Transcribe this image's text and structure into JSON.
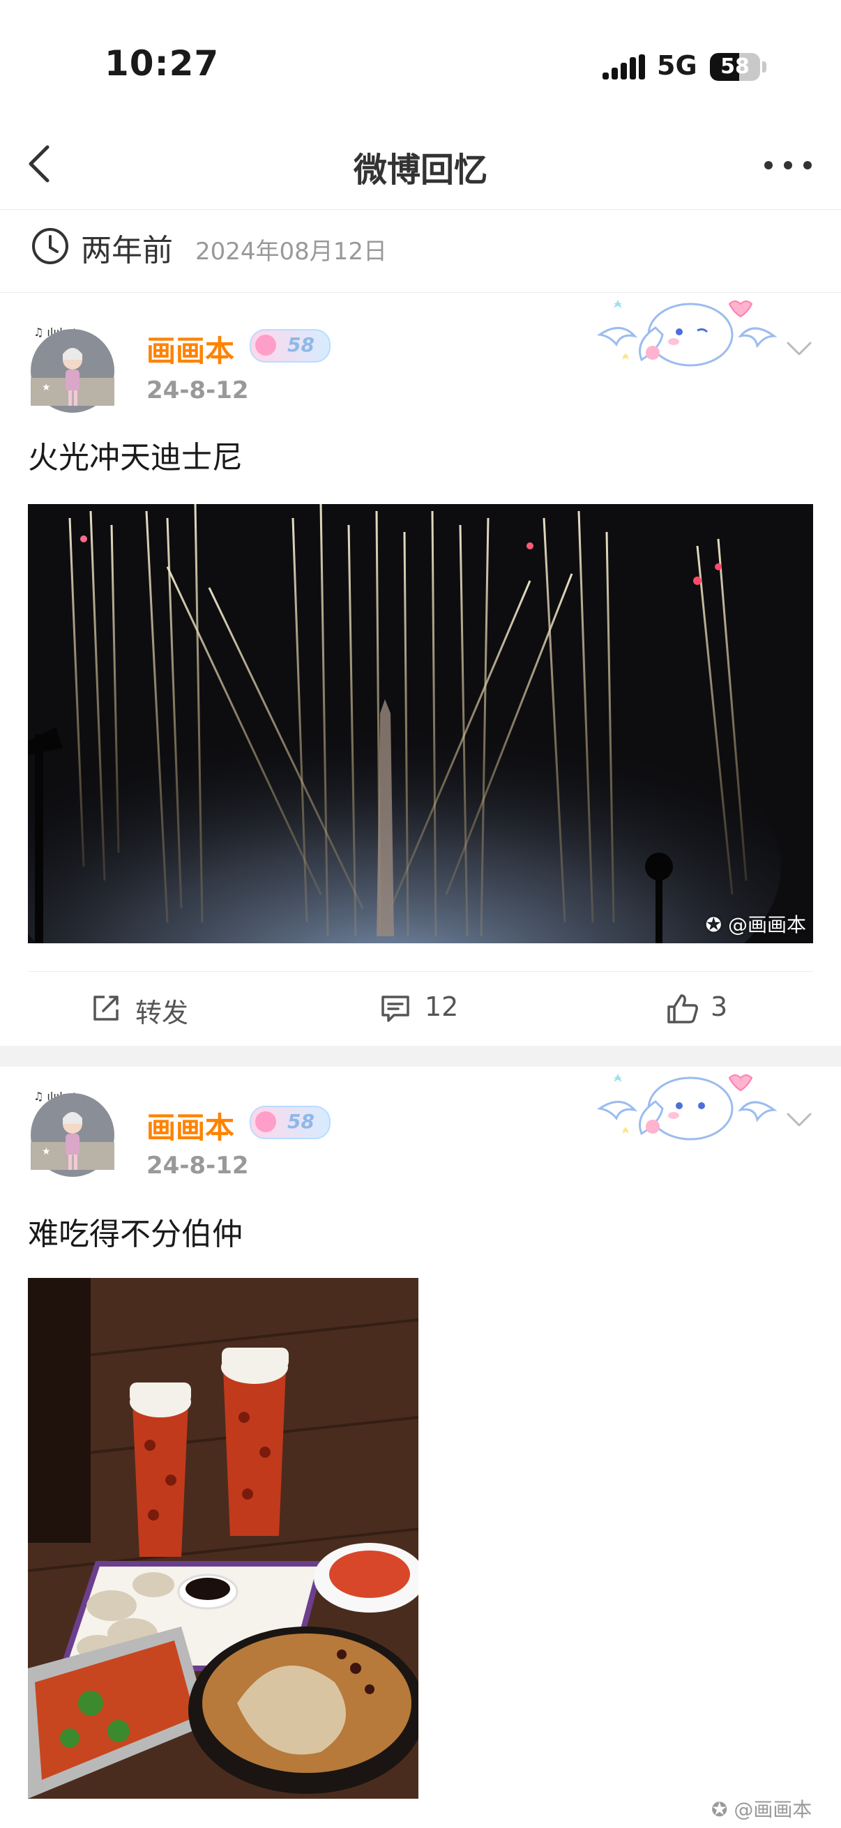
{
  "status": {
    "time": "10:27",
    "network": "5G",
    "battery": "58",
    "battery_level": 0.58
  },
  "nav": {
    "title": "微博回忆"
  },
  "memory": {
    "ago": "两年前",
    "date": "2024年08月12日"
  },
  "colors": {
    "username": "#ff8200",
    "meta": "#999999",
    "divider": "#ececec"
  },
  "posts": [
    {
      "username": "画画本",
      "badge": "58",
      "date": "24-8-12",
      "text": "火光冲天迪士尼",
      "watermark": "@画画本",
      "actions": {
        "repost": "转发",
        "comments": "12",
        "likes": "3"
      }
    },
    {
      "username": "画画本",
      "badge": "58",
      "date": "24-8-12",
      "text": "难吃得不分伯仲",
      "watermark": "@画画本"
    }
  ]
}
